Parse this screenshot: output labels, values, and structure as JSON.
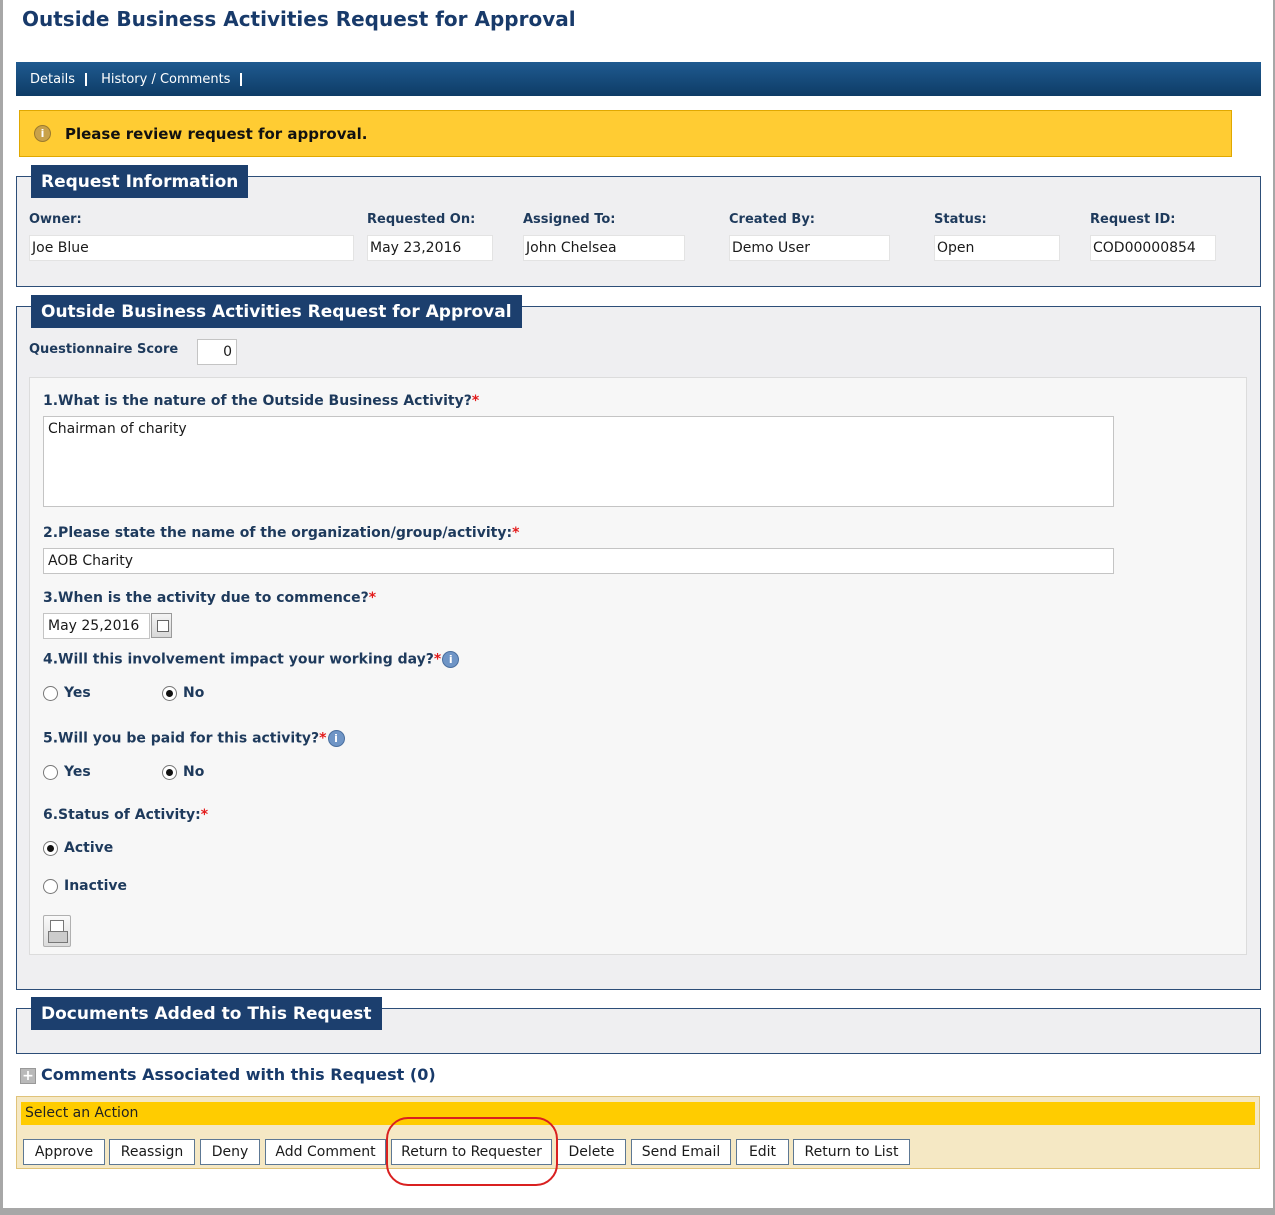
{
  "page": {
    "title": "Outside Business Activities Request for Approval"
  },
  "nav": {
    "details": "Details",
    "history": "History / Comments"
  },
  "alert": {
    "icon": "info-warning-icon",
    "message": "Please review request for approval."
  },
  "request_info": {
    "heading": "Request Information",
    "owner_label": "Owner:",
    "owner": "Joe Blue",
    "requested_on_label": "Requested On:",
    "requested_on": "May 23,2016",
    "assigned_to_label": "Assigned To:",
    "assigned_to": "John Chelsea",
    "created_by_label": "Created By:",
    "created_by": "Demo User",
    "status_label": "Status:",
    "status": "Open",
    "request_id_label": "Request ID:",
    "request_id": "COD00000854"
  },
  "form": {
    "heading": "Outside Business Activities Request for Approval",
    "score_label": "Questionnaire Score",
    "score": "0",
    "q1": {
      "label": "1.What is the nature of the Outside Business Activity?",
      "value": "Chairman of charity"
    },
    "q2": {
      "label": "2.Please state the name of the organization/group/activity:",
      "value": "AOB Charity"
    },
    "q3": {
      "label": "3.When is the activity due to commence?",
      "value": "May 25,2016"
    },
    "q4": {
      "label": "4.Will this involvement impact your working day?",
      "yes": "Yes",
      "no": "No",
      "selected": "No"
    },
    "q5": {
      "label": "5.Will you be paid for this activity?",
      "yes": "Yes",
      "no": "No",
      "selected": "No"
    },
    "q6": {
      "label": "6.Status of Activity:",
      "active": "Active",
      "inactive": "Inactive",
      "selected": "Active"
    },
    "required_mark": "*",
    "info_glyph": "i"
  },
  "documents": {
    "heading": "Documents Added to This Request"
  },
  "comments": {
    "title": "Comments Associated with this Request (0)",
    "expand_glyph": "+"
  },
  "actions": {
    "heading": "Select an Action",
    "approve": "Approve",
    "reassign": "Reassign",
    "deny": "Deny",
    "add_comment": "Add Comment",
    "return_to_requester": "Return to Requester",
    "delete": "Delete",
    "send_email": "Send Email",
    "edit": "Edit",
    "return_to_list": "Return to List"
  },
  "colors": {
    "brand_navy": "#1c3f6e",
    "alert_yellow": "#ffcc33",
    "action_yellow": "#ffcc00",
    "highlight_red": "#d92020"
  }
}
